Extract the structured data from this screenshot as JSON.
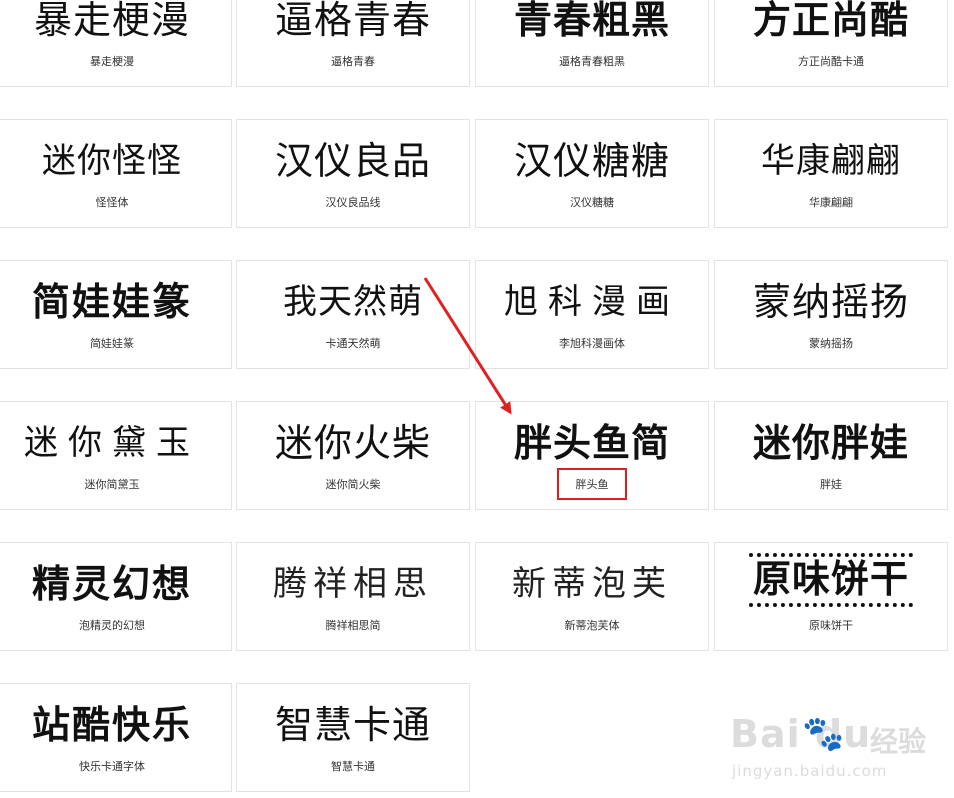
{
  "fonts": [
    {
      "sample": "暴走梗漫",
      "name": "暴走梗漫",
      "style": "s-light"
    },
    {
      "sample": "逼格青春",
      "name": "逼格青春",
      "style": "s-light"
    },
    {
      "sample": "青春粗黑",
      "name": "逼格青春粗黑",
      "style": "s-bold"
    },
    {
      "sample": "方正尚酷",
      "name": "方正尚酷卡通",
      "style": "s-bold"
    },
    {
      "sample": "迷你怪怪",
      "name": "怪怪体",
      "style": "s-small"
    },
    {
      "sample": "汉仪良品",
      "name": "汉仪良品线",
      "style": "s-light"
    },
    {
      "sample": "汉仪糖糖",
      "name": "汉仪糖糖",
      "style": "s-light"
    },
    {
      "sample": "华康翩翩",
      "name": "华康翩翩",
      "style": "s-small"
    },
    {
      "sample": "简娃娃篆",
      "name": "简娃娃篆",
      "style": "s-round"
    },
    {
      "sample": "我天然萌",
      "name": "卡通天然萌",
      "style": "s-small"
    },
    {
      "sample": "旭科漫画",
      "name": "李旭科漫画体",
      "style": "s-wide"
    },
    {
      "sample": "蒙纳摇扬",
      "name": "蒙纳摇扬",
      "style": "s-light"
    },
    {
      "sample": "迷你黛玉",
      "name": "迷你简黛玉",
      "style": "s-wide"
    },
    {
      "sample": "迷你火柴",
      "name": "迷你简火柴",
      "style": "s-light"
    },
    {
      "sample": "胖头鱼简",
      "name": "胖头鱼",
      "style": "s-bold"
    },
    {
      "sample": "迷你胖娃",
      "name": "胖娃",
      "style": "s-bold"
    },
    {
      "sample": "精灵幻想",
      "name": "泡精灵的幻想",
      "style": "s-round"
    },
    {
      "sample": "腾祥相思",
      "name": "腾祥相思简",
      "style": "s-thin"
    },
    {
      "sample": "新蒂泡芙",
      "name": "新蒂泡芙体",
      "style": "s-thin"
    },
    {
      "sample": "原味饼干",
      "name": "原味饼干",
      "style": "s-cookie"
    },
    {
      "sample": "站酷快乐",
      "name": "快乐卡通字体",
      "style": "s-round"
    },
    {
      "sample": "智慧卡通",
      "name": "智慧卡通",
      "style": "s-light"
    }
  ],
  "highlighted_font_index": 14,
  "colors": {
    "highlight": "#e02020",
    "arrow": "#e02020",
    "border": "#e3e3e3",
    "watermark": "#dcdcdc"
  },
  "watermark": {
    "logo_text": "Bai du",
    "logo_icon": "paw-icon",
    "suffix": "经验",
    "url": "jingyan.baidu.com"
  }
}
